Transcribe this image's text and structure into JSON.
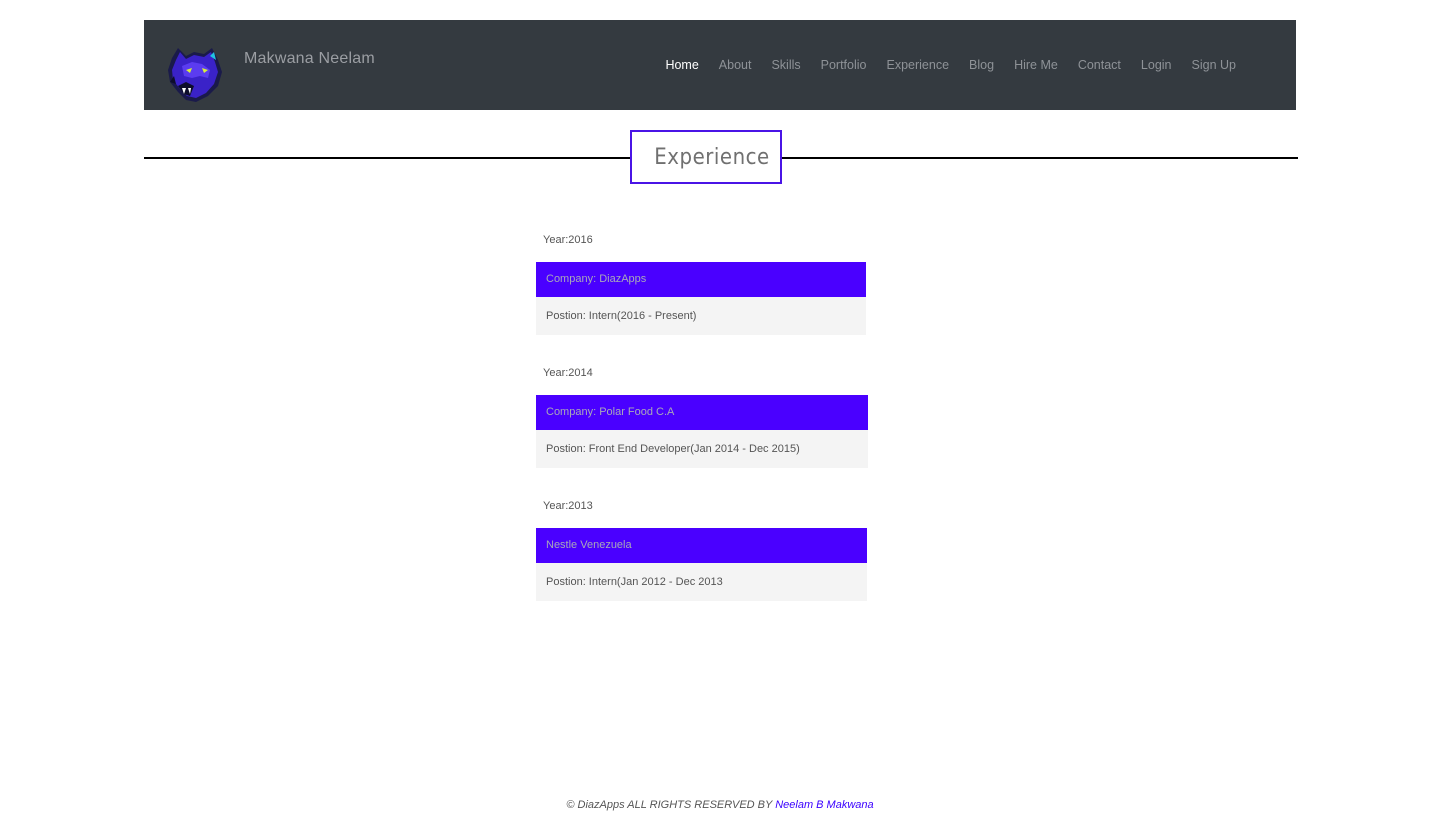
{
  "header": {
    "brand_name": "Makwana Neelam",
    "logo_icon": "panther-logo-icon"
  },
  "nav": {
    "items": [
      {
        "label": "Home",
        "active": true
      },
      {
        "label": "About",
        "active": false
      },
      {
        "label": "Skills",
        "active": false
      },
      {
        "label": "Portfolio",
        "active": false
      },
      {
        "label": "Experience",
        "active": false
      },
      {
        "label": "Blog",
        "active": false
      },
      {
        "label": "Hire Me",
        "active": false
      },
      {
        "label": "Contact",
        "active": false
      },
      {
        "label": "Login",
        "active": false
      },
      {
        "label": "Sign Up",
        "active": false
      }
    ]
  },
  "section": {
    "title": "Experience"
  },
  "experience": [
    {
      "year": "Year:2016",
      "company": "Company: DiazApps",
      "position": "Postion: Intern(2016 - Present)"
    },
    {
      "year": "Year:2014",
      "company": "Company: Polar Food C.A",
      "position": "Postion: Front End Developer(Jan 2014 - Dec 2015)"
    },
    {
      "year": "Year:2013",
      "company": "Nestle Venezuela",
      "position": "Postion: Intern(Jan 2012 - Dec 2013"
    }
  ],
  "footer": {
    "text": "© DiazApps ALL RIGHTS RESERVED BY ",
    "author_link": "Neelam B Makwana"
  },
  "colors": {
    "navbar_bg": "#343a40",
    "accent": "#4a00ff",
    "panel_bg": "#f4f4f4"
  }
}
